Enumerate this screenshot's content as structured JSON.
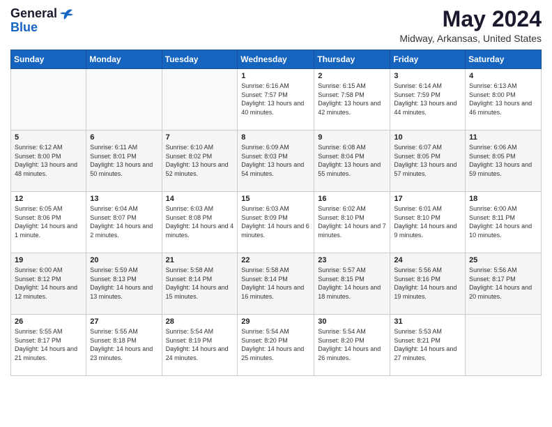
{
  "header": {
    "logo_general": "General",
    "logo_blue": "Blue",
    "month_year": "May 2024",
    "location": "Midway, Arkansas, United States"
  },
  "days_of_week": [
    "Sunday",
    "Monday",
    "Tuesday",
    "Wednesday",
    "Thursday",
    "Friday",
    "Saturday"
  ],
  "weeks": [
    [
      {
        "day": "",
        "content": ""
      },
      {
        "day": "",
        "content": ""
      },
      {
        "day": "",
        "content": ""
      },
      {
        "day": "1",
        "content": "Sunrise: 6:16 AM\nSunset: 7:57 PM\nDaylight: 13 hours\nand 40 minutes."
      },
      {
        "day": "2",
        "content": "Sunrise: 6:15 AM\nSunset: 7:58 PM\nDaylight: 13 hours\nand 42 minutes."
      },
      {
        "day": "3",
        "content": "Sunrise: 6:14 AM\nSunset: 7:59 PM\nDaylight: 13 hours\nand 44 minutes."
      },
      {
        "day": "4",
        "content": "Sunrise: 6:13 AM\nSunset: 8:00 PM\nDaylight: 13 hours\nand 46 minutes."
      }
    ],
    [
      {
        "day": "5",
        "content": "Sunrise: 6:12 AM\nSunset: 8:00 PM\nDaylight: 13 hours\nand 48 minutes."
      },
      {
        "day": "6",
        "content": "Sunrise: 6:11 AM\nSunset: 8:01 PM\nDaylight: 13 hours\nand 50 minutes."
      },
      {
        "day": "7",
        "content": "Sunrise: 6:10 AM\nSunset: 8:02 PM\nDaylight: 13 hours\nand 52 minutes."
      },
      {
        "day": "8",
        "content": "Sunrise: 6:09 AM\nSunset: 8:03 PM\nDaylight: 13 hours\nand 54 minutes."
      },
      {
        "day": "9",
        "content": "Sunrise: 6:08 AM\nSunset: 8:04 PM\nDaylight: 13 hours\nand 55 minutes."
      },
      {
        "day": "10",
        "content": "Sunrise: 6:07 AM\nSunset: 8:05 PM\nDaylight: 13 hours\nand 57 minutes."
      },
      {
        "day": "11",
        "content": "Sunrise: 6:06 AM\nSunset: 8:05 PM\nDaylight: 13 hours\nand 59 minutes."
      }
    ],
    [
      {
        "day": "12",
        "content": "Sunrise: 6:05 AM\nSunset: 8:06 PM\nDaylight: 14 hours\nand 1 minute."
      },
      {
        "day": "13",
        "content": "Sunrise: 6:04 AM\nSunset: 8:07 PM\nDaylight: 14 hours\nand 2 minutes."
      },
      {
        "day": "14",
        "content": "Sunrise: 6:03 AM\nSunset: 8:08 PM\nDaylight: 14 hours\nand 4 minutes."
      },
      {
        "day": "15",
        "content": "Sunrise: 6:03 AM\nSunset: 8:09 PM\nDaylight: 14 hours\nand 6 minutes."
      },
      {
        "day": "16",
        "content": "Sunrise: 6:02 AM\nSunset: 8:10 PM\nDaylight: 14 hours\nand 7 minutes."
      },
      {
        "day": "17",
        "content": "Sunrise: 6:01 AM\nSunset: 8:10 PM\nDaylight: 14 hours\nand 9 minutes."
      },
      {
        "day": "18",
        "content": "Sunrise: 6:00 AM\nSunset: 8:11 PM\nDaylight: 14 hours\nand 10 minutes."
      }
    ],
    [
      {
        "day": "19",
        "content": "Sunrise: 6:00 AM\nSunset: 8:12 PM\nDaylight: 14 hours\nand 12 minutes."
      },
      {
        "day": "20",
        "content": "Sunrise: 5:59 AM\nSunset: 8:13 PM\nDaylight: 14 hours\nand 13 minutes."
      },
      {
        "day": "21",
        "content": "Sunrise: 5:58 AM\nSunset: 8:14 PM\nDaylight: 14 hours\nand 15 minutes."
      },
      {
        "day": "22",
        "content": "Sunrise: 5:58 AM\nSunset: 8:14 PM\nDaylight: 14 hours\nand 16 minutes."
      },
      {
        "day": "23",
        "content": "Sunrise: 5:57 AM\nSunset: 8:15 PM\nDaylight: 14 hours\nand 18 minutes."
      },
      {
        "day": "24",
        "content": "Sunrise: 5:56 AM\nSunset: 8:16 PM\nDaylight: 14 hours\nand 19 minutes."
      },
      {
        "day": "25",
        "content": "Sunrise: 5:56 AM\nSunset: 8:17 PM\nDaylight: 14 hours\nand 20 minutes."
      }
    ],
    [
      {
        "day": "26",
        "content": "Sunrise: 5:55 AM\nSunset: 8:17 PM\nDaylight: 14 hours\nand 21 minutes."
      },
      {
        "day": "27",
        "content": "Sunrise: 5:55 AM\nSunset: 8:18 PM\nDaylight: 14 hours\nand 23 minutes."
      },
      {
        "day": "28",
        "content": "Sunrise: 5:54 AM\nSunset: 8:19 PM\nDaylight: 14 hours\nand 24 minutes."
      },
      {
        "day": "29",
        "content": "Sunrise: 5:54 AM\nSunset: 8:20 PM\nDaylight: 14 hours\nand 25 minutes."
      },
      {
        "day": "30",
        "content": "Sunrise: 5:54 AM\nSunset: 8:20 PM\nDaylight: 14 hours\nand 26 minutes."
      },
      {
        "day": "31",
        "content": "Sunrise: 5:53 AM\nSunset: 8:21 PM\nDaylight: 14 hours\nand 27 minutes."
      },
      {
        "day": "",
        "content": ""
      }
    ]
  ]
}
